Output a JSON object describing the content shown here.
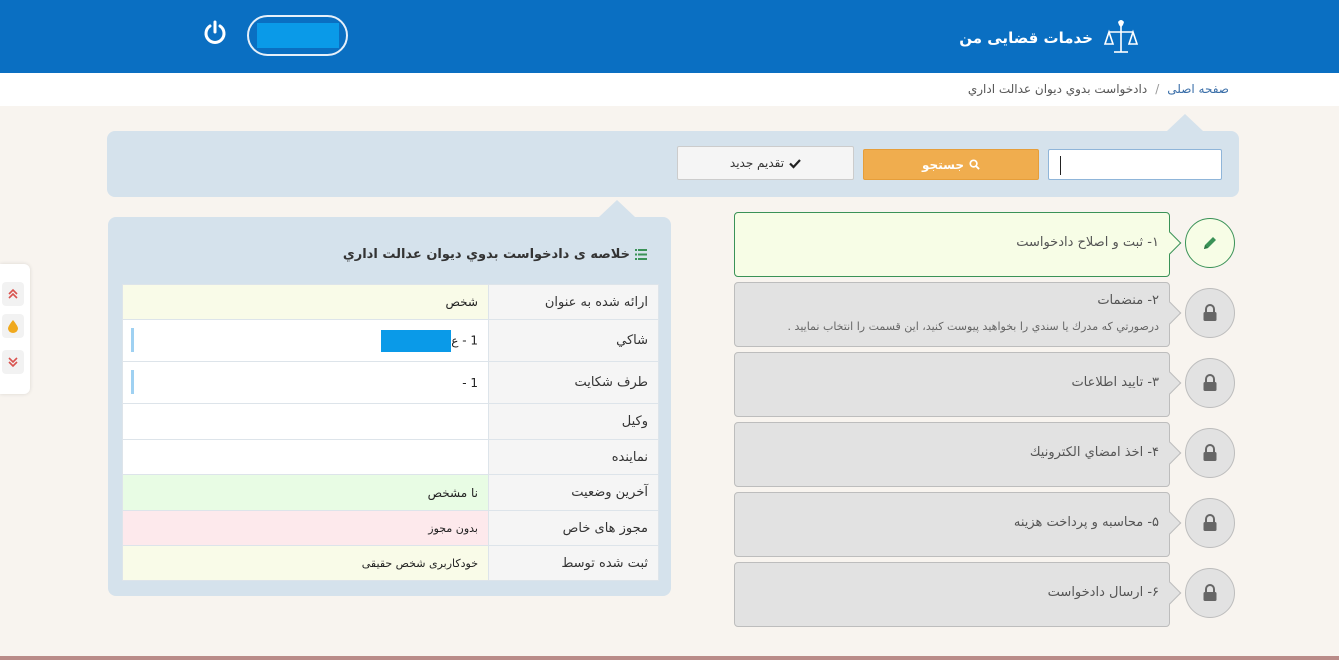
{
  "header": {
    "brand_title": "خدمات قضایی من",
    "icons": {
      "emblem": "iran-emblem-icon",
      "power": "power-icon"
    }
  },
  "breadcrumb": {
    "home": "صفحه اصلی",
    "separator": "/",
    "current": "دادخواست بدوي ديوان عدالت اداري"
  },
  "search": {
    "input_value": "",
    "search_label": "جستجو",
    "new_label": "تقدیم جدید",
    "icons": {
      "search": "search-icon",
      "new": "check-icon"
    }
  },
  "summary": {
    "title": "خلاصه ی دادخواست بدوي ديوان عدالت اداري",
    "icon": "list-icon",
    "rows": [
      {
        "label": "ارائه شده به عنوان",
        "value": "شخص"
      },
      {
        "label": "شاكي",
        "value": "1 - ع"
      },
      {
        "label": "طرف شكايت",
        "value": "1 -"
      },
      {
        "label": "وكيل",
        "value": ""
      },
      {
        "label": "نماينده",
        "value": ""
      },
      {
        "label": "آخرين وضعيت",
        "value": "نا مشخص"
      },
      {
        "label": "مجوز های خاص",
        "value": "بدون مجوز"
      },
      {
        "label": "ثبت شده توسط",
        "value": "خودکاربری شخص حقیقی"
      }
    ]
  },
  "steps": [
    {
      "title": "۱- ثبت و اصلاح دادخواست",
      "icon": "pencil-icon",
      "state": "active"
    },
    {
      "title": "۲- منضمات",
      "desc": "درصورتي كه مدرك يا سندي را بخواهيد پيوست كنيد، اين قسمت را انتخاب نماييد .",
      "icon": "lock-icon",
      "state": "locked"
    },
    {
      "title": "۳- تایید اطلاعات",
      "icon": "lock-icon",
      "state": "locked"
    },
    {
      "title": "۴- اخذ امضاي الكترونيك",
      "icon": "lock-icon",
      "state": "locked"
    },
    {
      "title": "۵- محاسبه و پرداخت هزینه",
      "icon": "lock-icon",
      "state": "locked"
    },
    {
      "title": "۶- ارسال دادخواست",
      "icon": "lock-icon",
      "state": "locked"
    }
  ],
  "float_widget": {
    "icons": [
      "double-chevron-up-icon",
      "drop-icon",
      "double-chevron-down-icon"
    ]
  },
  "colors": {
    "header_blue": "#0a6fc2",
    "search_orange": "#f0ad4e",
    "active_green": "#3a9257",
    "panel_blue": "#d5e2ec"
  }
}
